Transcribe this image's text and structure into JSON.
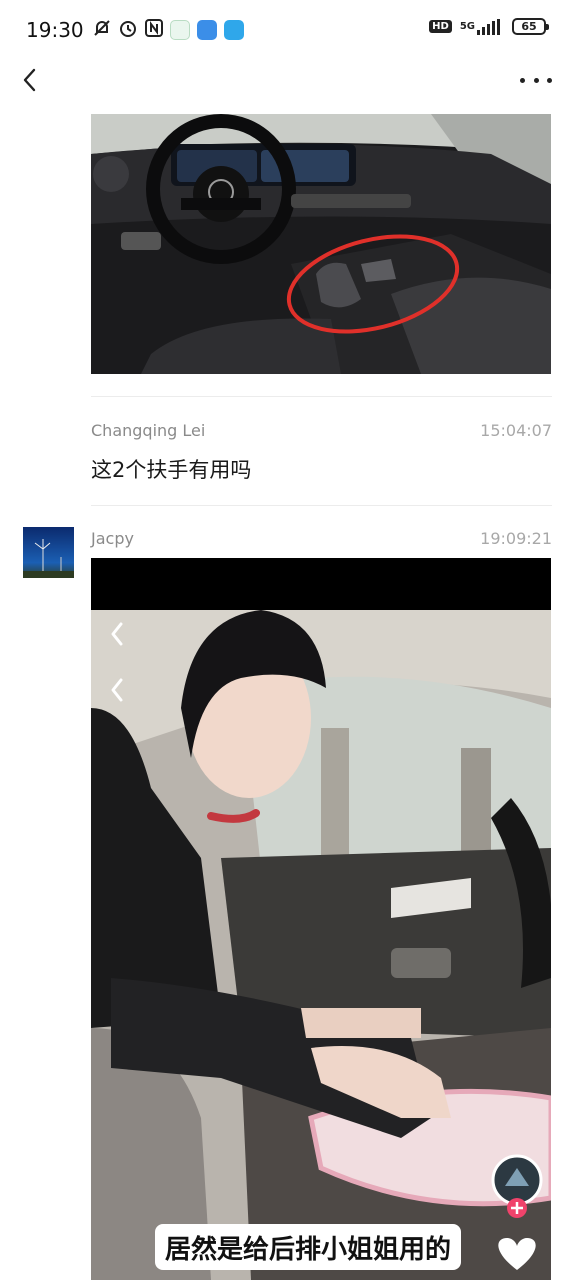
{
  "status_bar": {
    "time": "19:30",
    "network": "5G",
    "hd": "HD",
    "battery": "65"
  },
  "nav": {
    "back_icon": "chevron-left-icon",
    "more_icon": "more-dots-icon"
  },
  "comments": [
    {
      "name": "Changqing Lei",
      "time": "15:04:07",
      "text": "这2个扶手有用吗"
    },
    {
      "name": "Jacpy",
      "time": "19:09:21"
    }
  ],
  "video": {
    "caption": "居然是给后排小姐姐用的"
  },
  "colors": {
    "highlight_circle": "#e0302a",
    "like_button": "#ffffff",
    "plus_badge": "#f0436b"
  }
}
